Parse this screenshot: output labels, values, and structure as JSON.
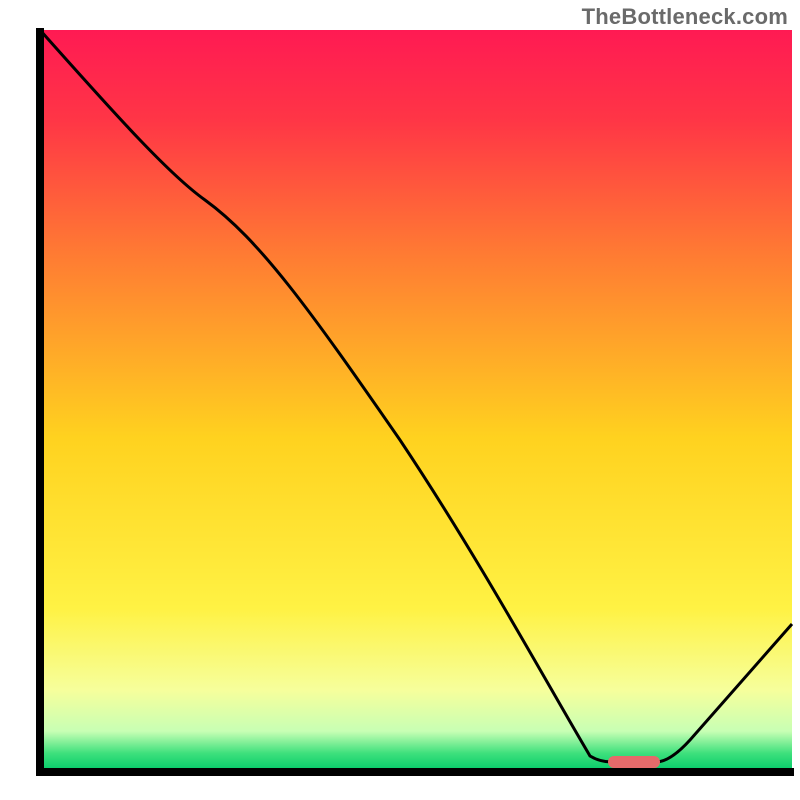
{
  "watermark": "TheBottleneck.com",
  "chart_data": {
    "type": "line",
    "note": "Single-series curve over a rainbow vertical gradient. No axes, ticks, or labels are visible in the image. X and Y are normalized 0–100 since no numeric scale is shown.",
    "title": "",
    "xlabel": "",
    "ylabel": "",
    "xlim": [
      0,
      100
    ],
    "ylim": [
      0,
      100
    ],
    "series": [
      {
        "name": "curve",
        "points": [
          {
            "x": 0,
            "y": 100
          },
          {
            "x": 22,
            "y": 77
          },
          {
            "x": 73,
            "y": 2
          },
          {
            "x": 76,
            "y": 1.5
          },
          {
            "x": 82,
            "y": 1.5
          },
          {
            "x": 100,
            "y": 20
          }
        ]
      }
    ],
    "marker": {
      "name": "optimal-zone",
      "x_range": [
        76,
        82
      ],
      "y": 1.5,
      "color": "#e66a6a"
    },
    "gradient_stops": [
      {
        "offset": 0.0,
        "color": "#ff1a53"
      },
      {
        "offset": 0.12,
        "color": "#ff3546"
      },
      {
        "offset": 0.3,
        "color": "#ff7a33"
      },
      {
        "offset": 0.55,
        "color": "#ffd21f"
      },
      {
        "offset": 0.78,
        "color": "#fff244"
      },
      {
        "offset": 0.89,
        "color": "#f6ff9c"
      },
      {
        "offset": 0.945,
        "color": "#c8ffb4"
      },
      {
        "offset": 0.975,
        "color": "#3de07c"
      },
      {
        "offset": 1.0,
        "color": "#00c968"
      }
    ],
    "axis_stroke": "#000000",
    "axis_width": 8
  }
}
